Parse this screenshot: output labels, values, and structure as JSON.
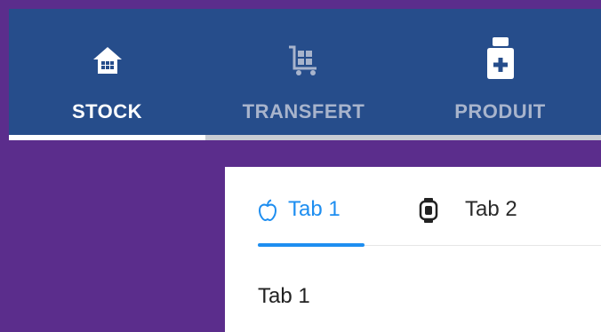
{
  "top_tabs": [
    {
      "label": "STOCK",
      "icon": "house-icon",
      "active": true
    },
    {
      "label": "TRANSFERT",
      "icon": "cart-icon",
      "active": false
    },
    {
      "label": "PRODUIT",
      "icon": "medicine-bottle-icon",
      "active": false
    }
  ],
  "bottom_tabs": [
    {
      "label": "Tab 1",
      "icon": "apple-icon",
      "active": true
    },
    {
      "label": "Tab 2",
      "icon": "android-icon",
      "active": false
    }
  ],
  "content": {
    "text": "Tab 1"
  },
  "colors": {
    "background": "#5b2d8c",
    "top_bar": "#264d8b",
    "active_accent": "#1e8ef0"
  }
}
